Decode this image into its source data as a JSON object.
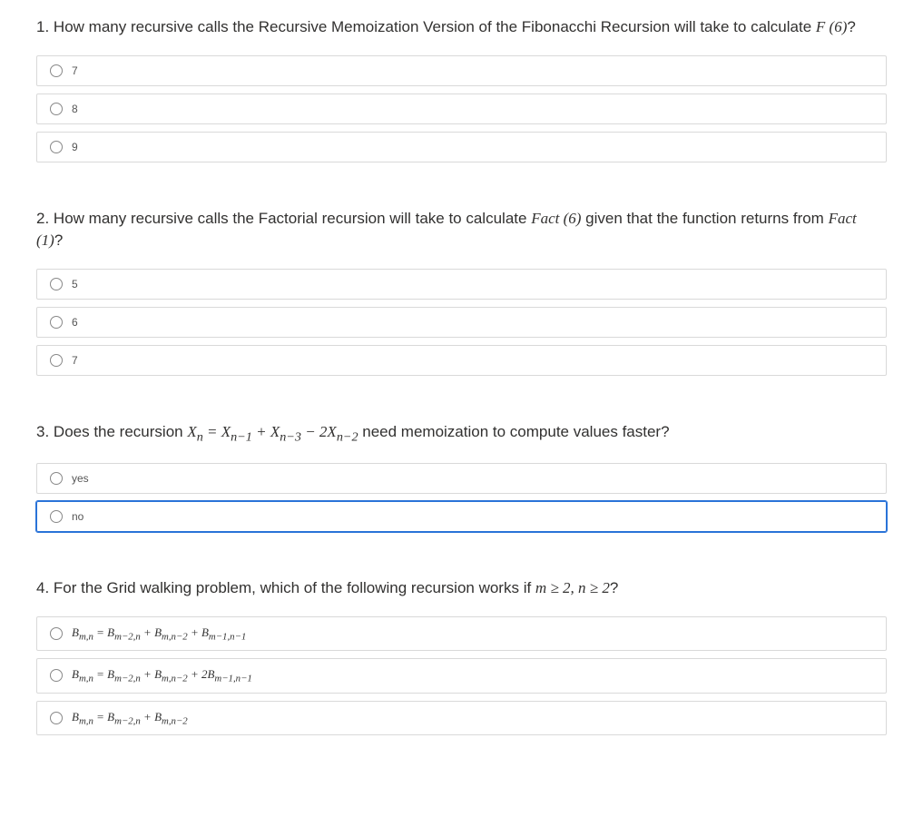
{
  "questions": [
    {
      "number": "1.",
      "text_prefix": "How many recursive calls the Recursive Memoization Version of the Fibonacchi Recursion will take to calculate ",
      "math": "F (6)",
      "text_suffix": "?",
      "options": [
        "7",
        "8",
        "9"
      ],
      "selected": null,
      "math_options": false
    },
    {
      "number": "2.",
      "text_prefix": "How many recursive calls the Factorial recursion will take to calculate ",
      "math": "Fact (6)",
      "text_mid": " given that the function returns from ",
      "math2": "Fact (1)",
      "text_suffix": "?",
      "options": [
        "5",
        "6",
        "7"
      ],
      "selected": null,
      "math_options": false
    },
    {
      "number": "3.",
      "text_prefix": "Does the recursion ",
      "math_html": "X<sub>n</sub> = X<sub>n−1</sub> + X<sub>n−3</sub> − 2X<sub>n−2</sub>",
      "text_suffix": " need memoization to compute values faster?",
      "options": [
        "yes",
        "no"
      ],
      "selected": 1,
      "math_options": false
    },
    {
      "number": "4.",
      "text_prefix": "For the Grid walking problem, which of the following recursion works if ",
      "math_html": "m ≥ 2, n ≥ 2",
      "text_suffix": "?",
      "options_html": [
        "B<sub>m,n</sub> = B<sub>m−2,n</sub> + B<sub>m,n−2</sub> + B<sub>m−1,n−1</sub>",
        "B<sub>m,n</sub> = B<sub>m−2,n</sub> + B<sub>m,n−2</sub> + 2B<sub>m−1,n−1</sub>",
        "B<sub>m,n</sub> = B<sub>m−2,n</sub> + B<sub>m,n−2</sub>"
      ],
      "selected": null,
      "math_options": true
    }
  ]
}
